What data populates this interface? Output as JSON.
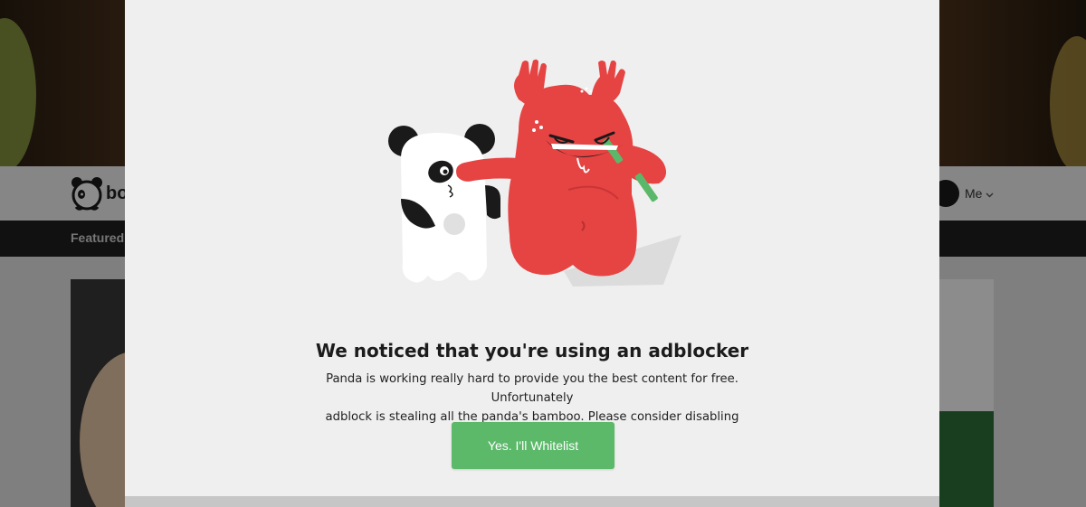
{
  "background": {
    "logo_text": "bo",
    "nav": {
      "featured_label": "Featured"
    },
    "user": {
      "me_label": "Me"
    }
  },
  "modal": {
    "headline": "We noticed that you're using an adblocker",
    "message_line1": "Panda is working really hard to provide you the best content for free. Unfortunately",
    "message_line2": "adblock is stealing all the panda's bamboo. Please consider disabling adblock.",
    "whitelist_button": "Yes. I'll Whitelist"
  },
  "colors": {
    "modal_background": "#efefef",
    "button_green": "#5cb96a",
    "monster_red": "#e64343",
    "panda_black": "#1a1a1a",
    "bamboo_green": "#5bb86a"
  },
  "icons": {
    "brand_logo": "panda-logo-icon",
    "chevron": "chevron-down-icon",
    "illustration": "panda-and-red-monster-illustration"
  }
}
